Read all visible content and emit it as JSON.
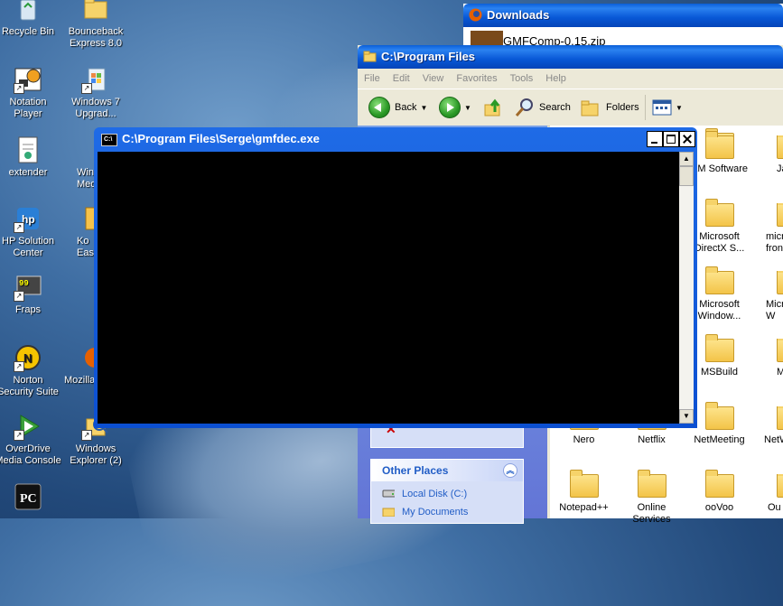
{
  "desktop": {
    "icons": [
      {
        "label": "Recycle Bin",
        "icon": "recycle-bin-icon"
      },
      {
        "label": "Bounceback\nExpress 8.0",
        "icon": "folder-icon"
      },
      {
        "label": "Notation\nPlayer",
        "icon": "notation-player-icon"
      },
      {
        "label": "Windows 7\nUpgrad...",
        "icon": "windows-upgrade-icon"
      },
      {
        "label": "extender",
        "icon": "document-icon"
      },
      {
        "label": "Wind\nMedia",
        "icon": "media-player-icon"
      },
      {
        "label": "HP Solution\nCenter",
        "icon": "hp-icon"
      },
      {
        "label": "Ko\nEasy",
        "icon": "app-icon"
      },
      {
        "label": "Fraps",
        "icon": "fraps-icon"
      },
      {
        "label": "Norton\nSecurity Suite",
        "icon": "norton-icon"
      },
      {
        "label": "Mozilla",
        "icon": "firefox-icon"
      },
      {
        "label": "OverDrive\nMedia Console",
        "icon": "overdrive-icon"
      },
      {
        "label": "Windows\nExplorer (2)",
        "icon": "explorer-icon"
      }
    ]
  },
  "downloads_window": {
    "title": "Downloads",
    "item": "GMFComp-0.15.zip"
  },
  "explorer_window": {
    "title": "C:\\Program Files",
    "menu": [
      "File",
      "Edit",
      "View",
      "Favorites",
      "Tools",
      "Help"
    ],
    "toolbar": {
      "back": "Back",
      "search": "Search",
      "folders": "Folders"
    },
    "other_places": {
      "header": "Other Places",
      "links": [
        "Local Disk (C:)",
        "My Documents"
      ]
    },
    "files": [
      {
        "label": "AM Software"
      },
      {
        "label": "Ja"
      },
      {
        "label": "Microsoft\nDirectX S..."
      },
      {
        "label": "micr\nfron"
      },
      {
        "label": "Microsoft\nWindow..."
      },
      {
        "label": "Micr\nW"
      },
      {
        "label": "MSBuild"
      },
      {
        "label": "M"
      },
      {
        "label": "Nero"
      },
      {
        "label": "Netflix"
      },
      {
        "label": "NetMeeting"
      },
      {
        "label": "NetW"
      },
      {
        "label": "Notepad++"
      },
      {
        "label": "Online\nServices"
      },
      {
        "label": "ooVoo"
      },
      {
        "label": "Ou"
      }
    ]
  },
  "console_window": {
    "title": "C:\\Program Files\\Serge\\gmfdec.exe",
    "icon_text": "C:\\"
  }
}
